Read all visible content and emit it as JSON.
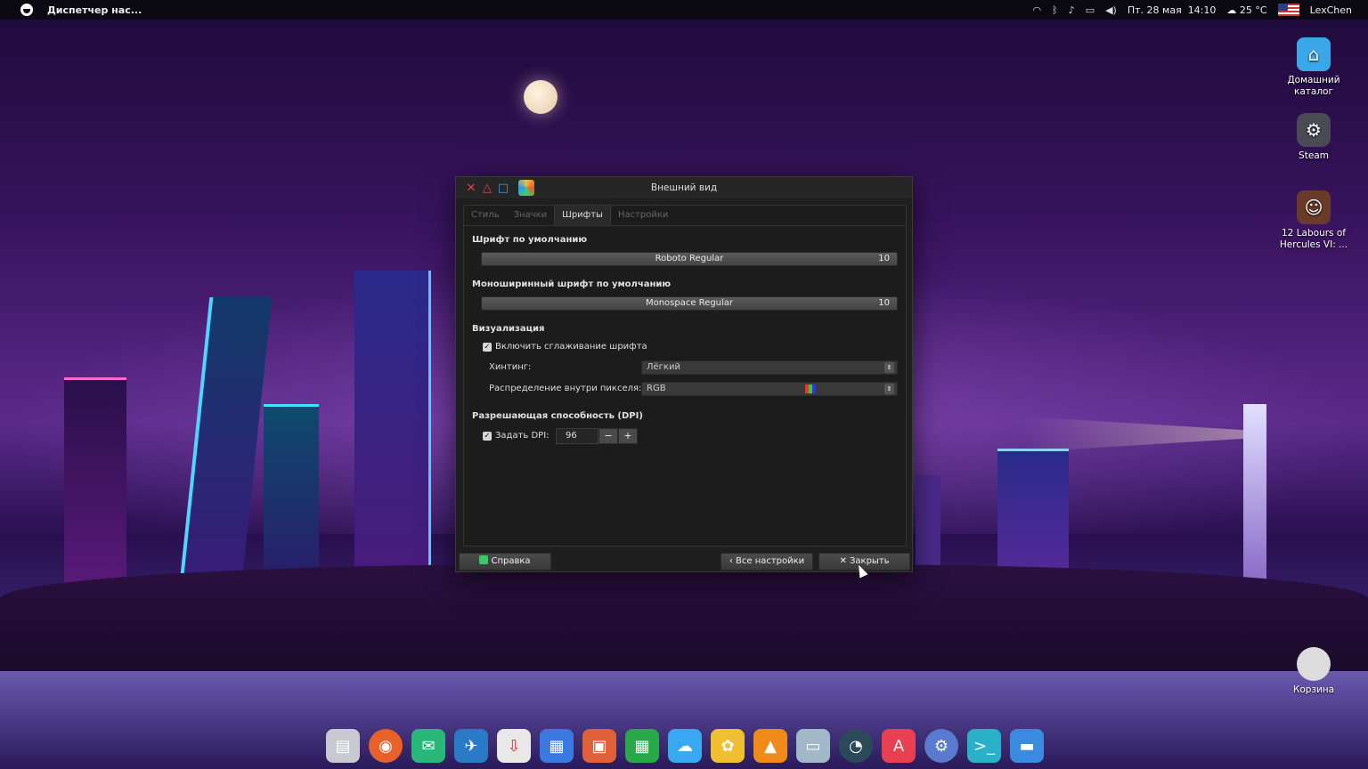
{
  "topbar": {
    "active_app": "Диспетчер нас...",
    "date": "Пт. 28 мая",
    "time": "14:10",
    "weather": "25 °C",
    "user": "LexChen"
  },
  "desktop_icons": [
    {
      "label": "Домашний каталог",
      "icon": "home-folder-icon"
    },
    {
      "label": "Steam",
      "icon": "steam-icon"
    },
    {
      "label": "12 Labours of Hercules VI: ...",
      "icon": "game-icon"
    },
    {
      "label": "Корзина",
      "icon": "trash-icon"
    }
  ],
  "window": {
    "title": "Внешний вид",
    "tabs": [
      "Стиль",
      "Значки",
      "Шрифты",
      "Настройки"
    ],
    "active_tab": "Шрифты",
    "default_font": {
      "section": "Шрифт по умолчанию",
      "name": "Roboto Regular",
      "size": "10"
    },
    "mono_font": {
      "section": "Моноширинный шрифт по умолчанию",
      "name": "Monospace Regular",
      "size": "10"
    },
    "rendering": {
      "section": "Визуализация",
      "antialias_label": "Включить сглаживание шрифта",
      "antialias_checked": true,
      "hinting_label": "Хинтинг:",
      "hinting_value": "Лёгкий",
      "subpixel_label": "Распределение внутри пикселя:",
      "subpixel_value": "RGB"
    },
    "dpi": {
      "section": "Разрешающая способность (DPI)",
      "set_label": "Задать DPI:",
      "set_checked": true,
      "value": "96",
      "minus": "−",
      "plus": "+"
    },
    "buttons": {
      "help": "Справка",
      "all_settings": "Все настройки",
      "close": "Закрыть"
    }
  },
  "dock": [
    "files-icon",
    "firefox-icon",
    "mail-icon",
    "chat-icon",
    "software-icon",
    "writer-icon",
    "presentation-icon",
    "spreadsheet-icon",
    "cloud-icon",
    "photos-icon",
    "vlc-icon",
    "image-viewer-icon",
    "speedometer-icon",
    "appstore-icon",
    "settings-icon",
    "terminal-icon",
    "workspaces-icon"
  ]
}
